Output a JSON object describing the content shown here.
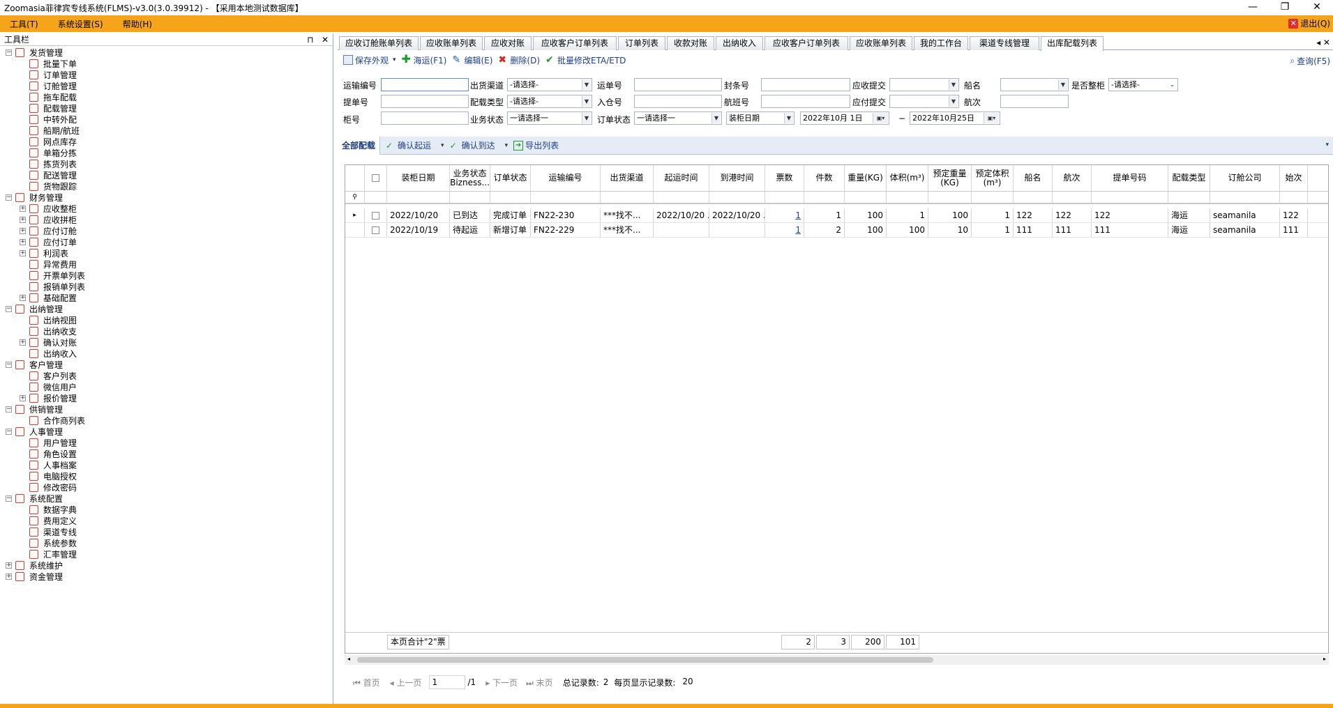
{
  "window": {
    "title": "Zoomasia菲律宾专线系统(FLMS)-v3.0(3.0.39912) - 【采用本地测试数据库】",
    "min": "—",
    "max": "❐",
    "close": "✕"
  },
  "menu": {
    "items": [
      "工具(T)",
      "系统设置(S)",
      "帮助(H)"
    ],
    "exit": "退出(Q)"
  },
  "left_pane": {
    "title": "工具栏",
    "pin": "ᵖ",
    "close": "✕",
    "tree": [
      {
        "label": "发货管理",
        "level": 0,
        "exp": "−"
      },
      {
        "label": "批量下单",
        "level": 1
      },
      {
        "label": "订单管理",
        "level": 1
      },
      {
        "label": "订舱管理",
        "level": 1
      },
      {
        "label": "拖车配载",
        "level": 1
      },
      {
        "label": "配载管理",
        "level": 1
      },
      {
        "label": "中转外配",
        "level": 1
      },
      {
        "label": "船期/航班",
        "level": 1
      },
      {
        "label": "网点库存",
        "level": 1
      },
      {
        "label": "单箱分拣",
        "level": 1
      },
      {
        "label": "拣货列表",
        "level": 1
      },
      {
        "label": "配送管理",
        "level": 1
      },
      {
        "label": "货物跟踪",
        "level": 1
      },
      {
        "label": "财务管理",
        "level": 0,
        "exp": "−"
      },
      {
        "label": "应收整柜",
        "level": 1,
        "exp": "+"
      },
      {
        "label": "应收拼柜",
        "level": 1,
        "exp": "+"
      },
      {
        "label": "应付订舱",
        "level": 1,
        "exp": "+"
      },
      {
        "label": "应付订单",
        "level": 1,
        "exp": "+"
      },
      {
        "label": "利润表",
        "level": 1,
        "exp": "+"
      },
      {
        "label": "异常费用",
        "level": 1
      },
      {
        "label": "开票单列表",
        "level": 1
      },
      {
        "label": "报销单列表",
        "level": 1
      },
      {
        "label": "基础配置",
        "level": 1,
        "exp": "+"
      },
      {
        "label": "出纳管理",
        "level": 0,
        "exp": "−"
      },
      {
        "label": "出纳视图",
        "level": 1
      },
      {
        "label": "出纳收支",
        "level": 1
      },
      {
        "label": "确认对账",
        "level": 1,
        "exp": "+"
      },
      {
        "label": "出纳收入",
        "level": 1
      },
      {
        "label": "客户管理",
        "level": 0,
        "exp": "−"
      },
      {
        "label": "客户列表",
        "level": 1
      },
      {
        "label": "微信用户",
        "level": 1
      },
      {
        "label": "报价管理",
        "level": 1,
        "exp": "+"
      },
      {
        "label": "供销管理",
        "level": 0,
        "exp": "−"
      },
      {
        "label": "合作商列表",
        "level": 1
      },
      {
        "label": "人事管理",
        "level": 0,
        "exp": "−"
      },
      {
        "label": "用户管理",
        "level": 1
      },
      {
        "label": "角色设置",
        "level": 1
      },
      {
        "label": "人事档案",
        "level": 1
      },
      {
        "label": "电脑授权",
        "level": 1
      },
      {
        "label": "修改密码",
        "level": 1
      },
      {
        "label": "系统配置",
        "level": 0,
        "exp": "−"
      },
      {
        "label": "数据字典",
        "level": 1
      },
      {
        "label": "费用定义",
        "level": 1
      },
      {
        "label": "渠道专线",
        "level": 1
      },
      {
        "label": "系统参数",
        "level": 1
      },
      {
        "label": "汇率管理",
        "level": 1
      },
      {
        "label": "系统维护",
        "level": 0,
        "exp": "+"
      },
      {
        "label": "资金管理",
        "level": 0,
        "exp": "+"
      }
    ]
  },
  "tabs": [
    "应收订舱账单列表",
    "应收账单列表",
    "应收对账",
    "应收客户订单列表",
    "订单列表",
    "收款对账",
    "出纳收入",
    "应收客户订单列表",
    "应收账单列表",
    "我的工作台",
    "渠道专线管理",
    "出库配载列表"
  ],
  "tabs_ctrls": "◂ ✕",
  "toolbar": {
    "save_view": "保存外观",
    "sea": "海运(F1)",
    "edit": "编辑(E)",
    "delete": "删除(D)",
    "batch_eta": "批量修改ETA/ETD",
    "query": "查询(F5)"
  },
  "filters": {
    "transport_no": "运输编号",
    "channel": "出货渠道",
    "channel_value": "-请选择-",
    "waybill": "运单号",
    "seal_no": "封条号",
    "ar_submit": "应收提交",
    "ship_name": "船名",
    "full_container": "是否整柜",
    "full_container_value": "-请选择-",
    "bl_no": "提单号",
    "load_type": "配载类型",
    "load_type_value": "-请选择-",
    "warehouse_no": "入仓号",
    "flight_no": "航班号",
    "ap_submit": "应付提交",
    "voyage": "航次",
    "container_no": "柜号",
    "biz_status": "业务状态",
    "biz_status_value": "一请选择一",
    "order_status": "订单状态",
    "order_status_value": "一请选择一",
    "date_type": "装柜日期",
    "date_from": "2022年10月 1日",
    "date_sep": "−",
    "date_to": "2022年10月25日"
  },
  "toolbar2": {
    "all": "全部配载",
    "confirm_depart": "确认起运",
    "confirm_arrive": "确认到达",
    "export": "导出列表",
    "more": "▾"
  },
  "grid": {
    "columns": [
      "装柜日期",
      "业务状态 Bizness...",
      "订单状态",
      "运输编号",
      "出货渠道",
      "起运时间",
      "到港时间",
      "票数",
      "件数",
      "重量(KG)",
      "体积(m³)",
      "预定重量 (KG)",
      "预定体积 (m³)",
      "船名",
      "航次",
      "提单号码",
      "配载类型",
      "订舱公司",
      "始次"
    ],
    "rows": [
      [
        "2022/10/20",
        "已到达",
        "完成订单",
        "FN22-230",
        "***找不...",
        "2022/10/20 ...",
        "2022/10/20 ...",
        "1",
        "1",
        "100",
        "1",
        "100",
        "1",
        "122",
        "122",
        "122",
        "海运",
        "seamanila",
        "122"
      ],
      [
        "2022/10/19",
        "待起运",
        "新增订单",
        "FN22-229",
        "***找不...",
        "",
        "",
        "1",
        "2",
        "100",
        "100",
        "10",
        "1",
        "111",
        "111",
        "111",
        "海运",
        "seamanila",
        "111"
      ]
    ],
    "footer": {
      "page_total": "本页合计\"2\"票",
      "pieces": "2",
      "weight": "3",
      "volume": "200",
      "extra": "101"
    }
  },
  "pager": {
    "first": "首页",
    "prev": "上一页",
    "page": "1",
    "of": "/1",
    "next": "下一页",
    "last": "末页",
    "total_label": "总记录数:",
    "total": "2",
    "per_page_label": "每页显示记录数:",
    "per_page": "20"
  },
  "colors": {
    "menubar": "#f6a51b",
    "link": "#1a3fa8",
    "toolbar_text": "#1c3f8a"
  }
}
